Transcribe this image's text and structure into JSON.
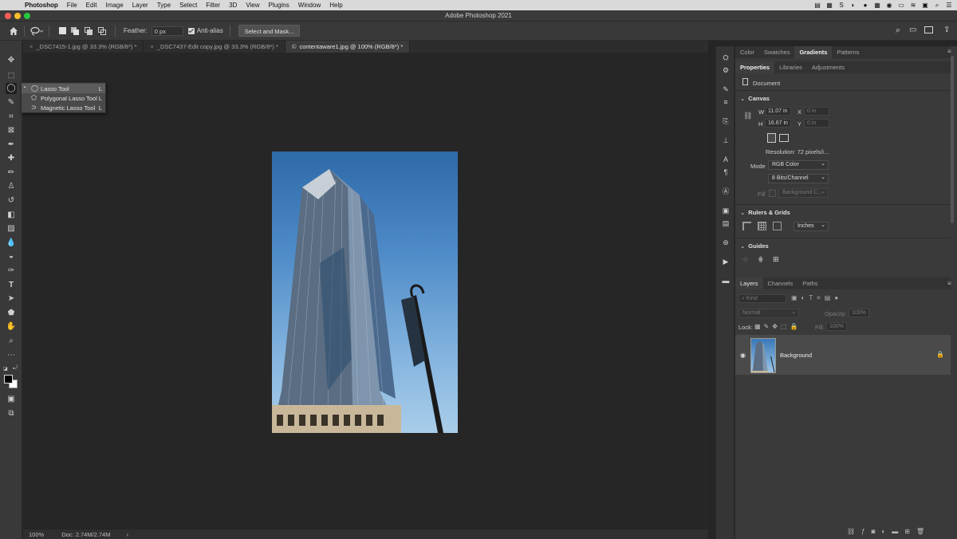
{
  "menubar": {
    "app": "Photoshop",
    "items": [
      "File",
      "Edit",
      "Image",
      "Layer",
      "Type",
      "Select",
      "Filter",
      "3D",
      "View",
      "Plugins",
      "Window",
      "Help"
    ]
  },
  "window": {
    "title": "Adobe Photoshop 2021",
    "traffic_colors": [
      "#ff5f57",
      "#febc2e",
      "#28c840"
    ]
  },
  "options": {
    "feather_label": "Feather:",
    "feather_value": "0 px",
    "antialias_label": "Anti-alias",
    "select_mask_label": "Select and Mask..."
  },
  "tabs": [
    {
      "label": "_DSC7415-1.jpg @ 33.3% (RGB/8*) *",
      "close": "×"
    },
    {
      "label": "_DSC7437-Edit copy.jpg @ 33.3% (RGB/8*) *",
      "close": "×"
    },
    {
      "label": "contentaware1.jpg @ 100% (RGB/8*) *",
      "close": "©"
    }
  ],
  "flyout": {
    "items": [
      {
        "label": "Lasso Tool",
        "key": "L"
      },
      {
        "label": "Polygonal Lasso Tool",
        "key": "L"
      },
      {
        "label": "Magnetic Lasso Tool",
        "key": "L"
      }
    ]
  },
  "status": {
    "zoom": "100%",
    "doc": "Doc: 2.74M/2.74M",
    "arrow": "›"
  },
  "top_panel_tabs": [
    "Color",
    "Swatches",
    "Gradients",
    "Patterns"
  ],
  "props_tabs": [
    "Properties",
    "Libraries",
    "Adjustments"
  ],
  "properties": {
    "document_label": "Document",
    "canvas_title": "Canvas",
    "w_label": "W",
    "w_value": "11.07 in",
    "h_label": "H",
    "h_value": "16.67 in",
    "x_label": "X",
    "x_value": "0 in",
    "y_label": "Y",
    "y_value": "0 in",
    "resolution": "Resolution: 72 pixels/i...",
    "mode_label": "Mode",
    "mode_value": "RGB Color",
    "bits_value": "8 Bits/Channel",
    "fill_label": "Fill",
    "fill_value": "Background C...",
    "rulers_title": "Rulers & Grids",
    "units_value": "Inches",
    "guides_title": "Guides"
  },
  "layers": {
    "tabs": [
      "Layers",
      "Channels",
      "Paths"
    ],
    "kind_placeholder": "Kind",
    "blend_mode": "Normal",
    "opacity_label": "Opacity:",
    "opacity_value": "100%",
    "lock_label": "Lock:",
    "fill_label": "Fill:",
    "fill_value": "100%",
    "layer_name": "Background"
  }
}
